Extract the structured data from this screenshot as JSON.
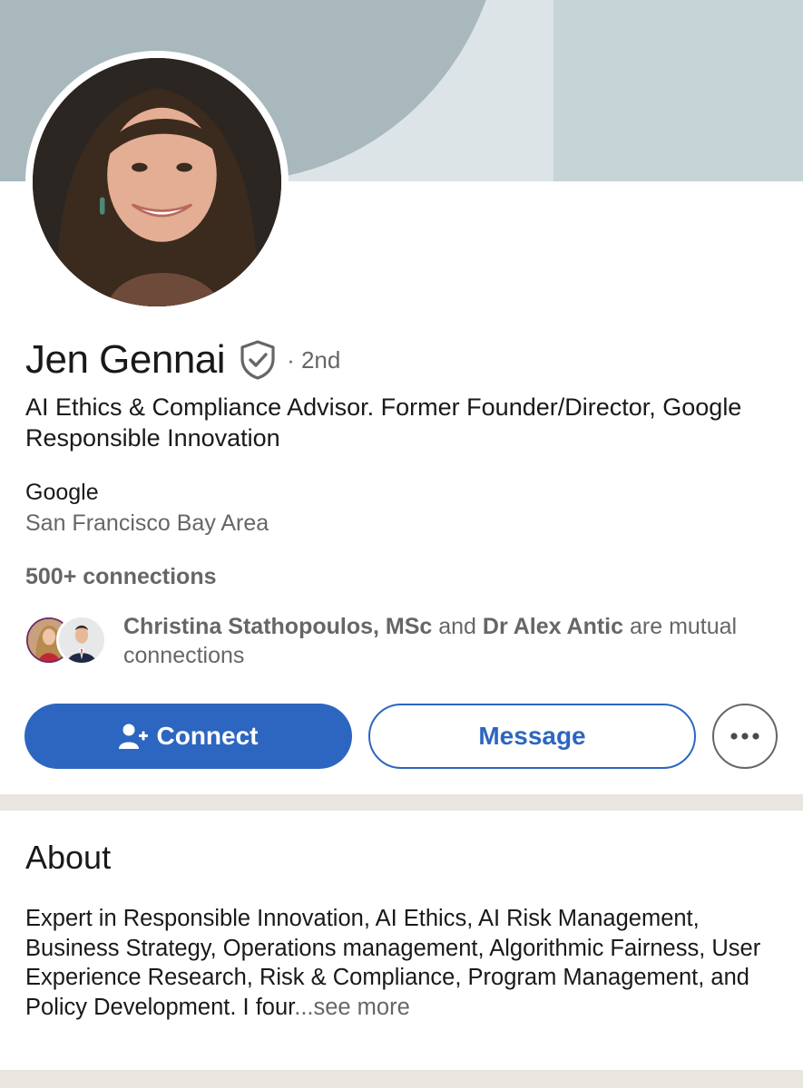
{
  "profile": {
    "name": "Jen Gennai",
    "degree": "· 2nd",
    "headline": "AI Ethics & Compliance Advisor. Former Founder/Director, Google Responsible Innovation",
    "company": "Google",
    "location": "San Francisco Bay Area",
    "connections": "500+ connections"
  },
  "mutual": {
    "person1": "Christina Stathopoulos, MSc",
    "and": " and ",
    "person2": "Dr Alex Antic",
    "suffix": " are mutual connections"
  },
  "actions": {
    "connect_label": "Connect",
    "message_label": "Message",
    "more_icon": "ellipsis-icon"
  },
  "about": {
    "title": "About",
    "text": "Expert in Responsible Innovation, AI Ethics, AI Risk Management, Business Strategy, Operations management, Algorithmic Fairness, User Experience Research, Risk & Compliance, Program Management, and Policy Development. I four",
    "see_more": "...see more"
  },
  "colors": {
    "primary": "#2c66c0",
    "banner_left": "#a8b8bc",
    "banner_right": "#c6d3d7",
    "divider": "#e9e5df"
  }
}
